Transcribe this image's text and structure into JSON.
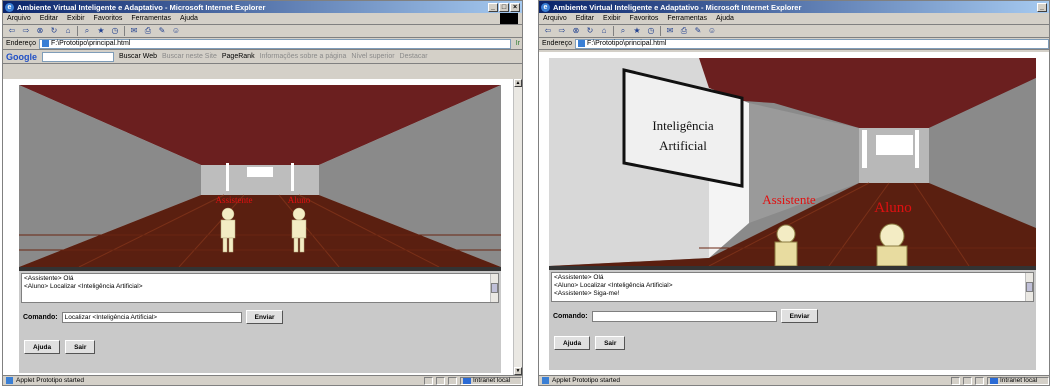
{
  "windows": [
    {
      "title": "Ambiente Virtual Inteligente e Adaptativo - Microsoft Internet Explorer",
      "menu": [
        "Arquivo",
        "Editar",
        "Exibir",
        "Favoritos",
        "Ferramentas",
        "Ajuda"
      ],
      "address_label": "Endereço",
      "address": "F:\\Prototipo\\principal.html",
      "go_label": "Ir",
      "google": {
        "logo": "Google",
        "search_web": "Buscar Web",
        "search_site": "Buscar neste Site",
        "pagerank": "PageRank",
        "page_info": "Informações sobre a página",
        "up_level": "Nível superior",
        "highlight": "Destacar"
      },
      "scene": {
        "label_assistant": "Assistente",
        "label_student": "Aluno"
      },
      "log_lines": [
        "<Assistente> Olá",
        "<Aluno> Localizar <Inteligência Artificial>"
      ],
      "command_label": "Comando:",
      "command_value": "Localizar <Inteligência Artificial>",
      "send_button": "Enviar",
      "help_button": "Ajuda",
      "exit_button": "Sair",
      "status_text": "Applet Prototipo started",
      "zone_text": "Intranet local"
    },
    {
      "title": "Ambiente Virtual Inteligente e Adaptativo - Microsoft Internet Explorer",
      "menu": [
        "Arquivo",
        "Editar",
        "Exibir",
        "Favoritos",
        "Ferramentas",
        "Ajuda"
      ],
      "address_label": "Endereço",
      "address": "F:\\Prototipo\\principal.html",
      "scene": {
        "label_assistant": "Assistente",
        "label_student": "Aluno",
        "sign_line1": "Inteligência",
        "sign_line2": "Artificial"
      },
      "log_lines": [
        "<Assistente> Olá",
        "<Aluno> Localizar <Inteligência Artificial>",
        "<Assistente> Siga-me!"
      ],
      "command_label": "Comando:",
      "command_value": "",
      "send_button": "Enviar",
      "help_button": "Ajuda",
      "exit_button": "Sair",
      "status_text": "Applet Prototipo started",
      "zone_text": "Intranet local"
    }
  ],
  "colors": {
    "ceiling": "#6b1f1f",
    "wall": "#8a8a8a",
    "floor": "#5a1f10",
    "label": "#e01010",
    "figure": "#f3ecc4"
  }
}
